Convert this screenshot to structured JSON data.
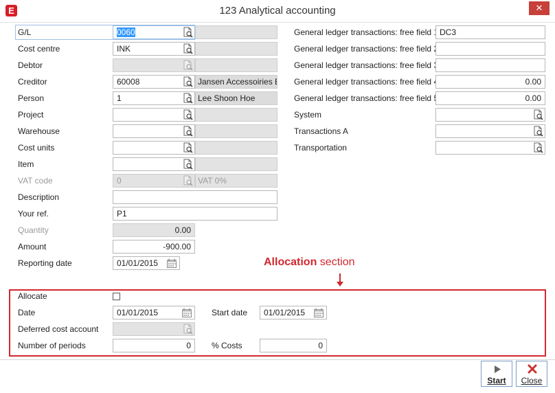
{
  "window": {
    "title": "123 Analytical accounting",
    "close_glyph": "✕",
    "app_icon_glyph": "E",
    "accent": "#d81e28"
  },
  "left": {
    "gl": {
      "label": "G/L",
      "value": "0060"
    },
    "cost_centre": {
      "label": "Cost centre",
      "value": "INK"
    },
    "debtor": {
      "label": "Debtor",
      "value": ""
    },
    "creditor": {
      "label": "Creditor",
      "value": "60008",
      "desc": "Jansen Accessoiries Ent"
    },
    "person": {
      "label": "Person",
      "value": "1",
      "desc": "Lee Shoon Hoe"
    },
    "project": {
      "label": "Project",
      "value": ""
    },
    "warehouse": {
      "label": "Warehouse",
      "value": ""
    },
    "cost_units": {
      "label": "Cost units",
      "value": ""
    },
    "item": {
      "label": "Item",
      "value": ""
    },
    "vat_code": {
      "label": "VAT code",
      "value": "0",
      "desc": "VAT 0%"
    },
    "description": {
      "label": "Description",
      "value": ""
    },
    "your_ref": {
      "label": "Your ref.",
      "value": "P1"
    },
    "quantity": {
      "label": "Quantity",
      "value": "0.00"
    },
    "amount": {
      "label": "Amount",
      "value": "-900.00"
    },
    "reporting_date": {
      "label": "Reporting date",
      "value": "01/01/2015"
    }
  },
  "right": {
    "ff1": {
      "label": "General ledger transactions: free field 1",
      "value": "DC3"
    },
    "ff2": {
      "label": "General ledger transactions: free field 2",
      "value": ""
    },
    "ff3": {
      "label": "General ledger transactions: free field 3",
      "value": ""
    },
    "ff4": {
      "label": "General ledger transactions: free field 4",
      "value": "0.00"
    },
    "ff5": {
      "label": "General ledger transactions: free field 5",
      "value": "0.00"
    },
    "system": {
      "label": "System",
      "value": ""
    },
    "transactions_a": {
      "label": "Transactions A",
      "value": ""
    },
    "transportation": {
      "label": "Transportation",
      "value": ""
    }
  },
  "annotation": {
    "bold": "Allocation",
    "rest": " section",
    "color": "#d0282e"
  },
  "allocation": {
    "allocate": {
      "label": "Allocate",
      "checked": false
    },
    "date": {
      "label": "Date",
      "value": "01/01/2015"
    },
    "start_date": {
      "label": "Start date",
      "value": "01/01/2015"
    },
    "deferred": {
      "label": "Deferred cost account",
      "value": ""
    },
    "periods": {
      "label": "Number of periods",
      "value": "0"
    },
    "costs": {
      "label": "% Costs",
      "value": "0"
    }
  },
  "buttons": {
    "start": {
      "label": "Start",
      "icon": "play-icon"
    },
    "close": {
      "label": "Close",
      "icon": "close-icon"
    }
  }
}
